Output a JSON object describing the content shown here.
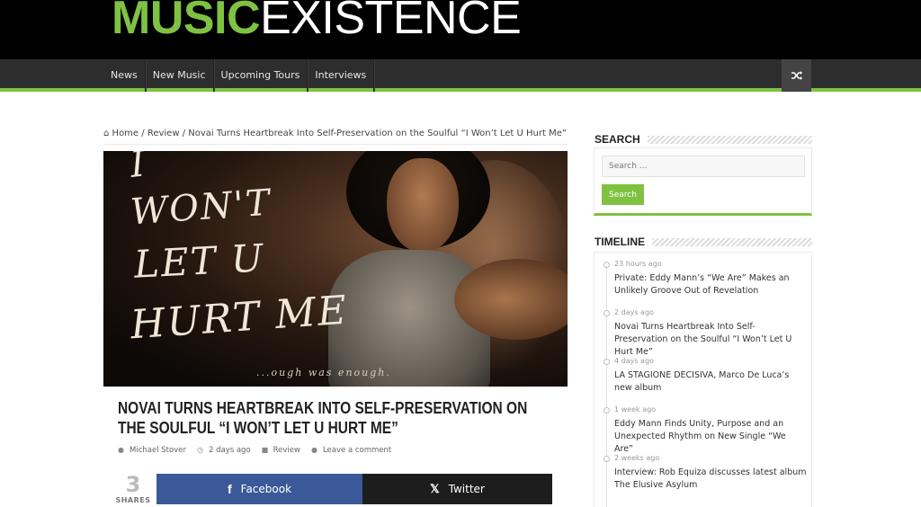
{
  "site": {
    "logo_part_a": "MUSIC",
    "logo_part_b": "EXISTENCE",
    "brand_color": "#7fc242"
  },
  "nav": {
    "items": [
      {
        "label": "News"
      },
      {
        "label": "New Music"
      },
      {
        "label": "Upcoming Tours"
      },
      {
        "label": "Interviews"
      }
    ],
    "random_icon": "shuffle-icon"
  },
  "breadcrumb": {
    "home": "Home",
    "sep1": "/",
    "category": "Review",
    "sep2": "/",
    "current": "Novai Turns Heartbreak Into Self-Preservation on the Soulful “I Won’t Let U Hurt Me”"
  },
  "feature_image": {
    "text_lines": [
      "I",
      "WON'T",
      "LET U",
      "HURT ME"
    ],
    "tagline": "...ough was enough."
  },
  "post": {
    "title": "Novai Turns Heartbreak Into Self-Preservation on the Soulful “I Won’t Let U Hurt Me”",
    "author": "Michael Stover",
    "date": "2 days ago",
    "category": "Review",
    "comments": "Leave a comment"
  },
  "share": {
    "count": "3",
    "count_label": "SHARES",
    "facebook_label": "Facebook",
    "twitter_label": "Twitter",
    "facebook_color": "#3b5998",
    "twitter_color": "#1d1d1d"
  },
  "sidebar": {
    "search": {
      "title": "SEARCH",
      "placeholder": "Search ...",
      "button_label": "Search"
    },
    "timeline": {
      "title": "TIMELINE",
      "items": [
        {
          "date": "23 hours ago",
          "title": "Private: Eddy Mann’s “We Are” Makes an Unlikely Groove Out of Revelation"
        },
        {
          "date": "2 days ago",
          "title": "Novai Turns Heartbreak Into Self-Preservation on the Soulful “I Won’t Let U Hurt Me”"
        },
        {
          "date": "4 days ago",
          "title": "LA STAGIONE DECISIVA, Marco De Luca’s new album"
        },
        {
          "date": "1 week ago",
          "title": "Eddy Mann Finds Unity, Purpose and an Unexpected Rhythm on New Single “We Are”"
        },
        {
          "date": "2 weeks ago",
          "title": "Interview: Rob Equiza discusses latest album The Elusive Asylum"
        }
      ]
    }
  }
}
